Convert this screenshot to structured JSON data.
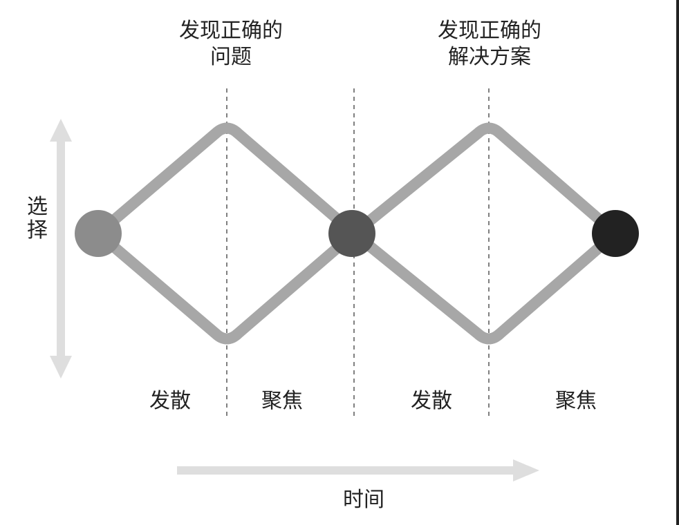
{
  "headings": [
    {
      "line1": "发现正确的",
      "line2": "问题"
    },
    {
      "line1": "发现正确的",
      "line2": "解决方案"
    }
  ],
  "phases": [
    "发散",
    "聚焦",
    "发散",
    "聚焦"
  ],
  "y_axis_label": [
    "选",
    "择"
  ],
  "x_axis_label": "时间",
  "colors": {
    "curve": "#a7a7a7",
    "arrow": "#dedede",
    "start_node": "#8c8c8c",
    "middle_node": "#555555",
    "end_node": "#222222",
    "dashed_line": "#555555"
  }
}
